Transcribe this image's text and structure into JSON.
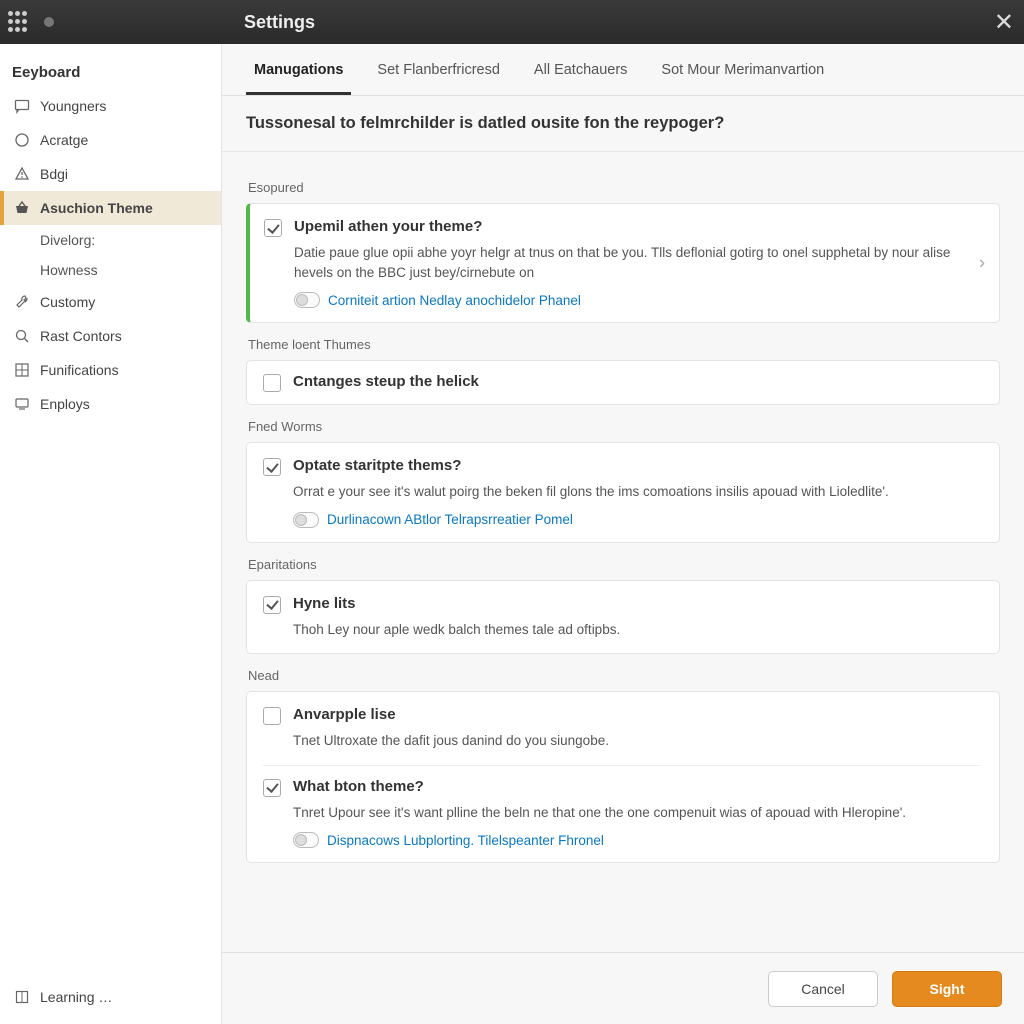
{
  "titlebar": {
    "title": "Settings"
  },
  "sidebar": {
    "header": "Eeyboard",
    "items": [
      {
        "label": "Youngners",
        "icon": "message"
      },
      {
        "label": "Acratge",
        "icon": "circle"
      },
      {
        "label": "Bdgi",
        "icon": "warning"
      },
      {
        "label": "Asuchion Theme",
        "icon": "basket",
        "active": true,
        "children": [
          {
            "label": "Divelorg:"
          },
          {
            "label": "Howness"
          }
        ]
      },
      {
        "label": "Customy",
        "icon": "wrench"
      },
      {
        "label": "Rast Contors",
        "icon": "search"
      },
      {
        "label": "Funifications",
        "icon": "grid"
      },
      {
        "label": "Enploys",
        "icon": "monitor"
      }
    ],
    "bottom": {
      "label": "Learning  …",
      "icon": "book"
    }
  },
  "tabs": [
    {
      "label": "Manugations",
      "active": true
    },
    {
      "label": "Set Flanberfricresd"
    },
    {
      "label": "All Eatchauers"
    },
    {
      "label": "Sot Mour Merimanvartion"
    }
  ],
  "banner": "Tussonesal to felmrchilder is datled ousite fon the reypoger?",
  "sections": {
    "s1": {
      "label": "Esopured",
      "title": "Upemil athen your theme?",
      "desc": "Datie paue glue opii abhe yoyr helgr at tnus on that be you. Tlls deflonial gotirg to onel supphetal by nour alise hevels on the BBC just bey/cirnebute on",
      "link": "Corniteit artion Nedlay anochidelor Phanel"
    },
    "s2": {
      "label": "Theme loent Thumes",
      "title": "Cntanges steup the helick"
    },
    "s3": {
      "label": "Fned Worms",
      "title": "Optate staritpte thems?",
      "desc": "Orrat e your see it's walut poirg the beken fil glons the ims comoations insilis apouad with Lioledlite'.",
      "link": "Durlinacown ABtlor Telrapsrreatier Pomel"
    },
    "s4": {
      "label": "Eparitations",
      "title": "Hyne lits",
      "desc": "Thoh Ley nour aple wedk balch themes tale ad oftipbs."
    },
    "s5": {
      "label": "Nead",
      "row1_title": "Anvarpple lise",
      "row1_desc": "Tnet Ultroxate the dafit jous danind do you siungobe.",
      "row2_title": "What bton theme?",
      "row2_desc": "Tnret Upour see it's want plline the beln ne that one the one compenuit wias of apouad with Hleropine'.",
      "link": "Dispnacows Lubplorting. Tilelspeanter Fhronel"
    }
  },
  "footer": {
    "cancel": "Cancel",
    "save": "Sight"
  }
}
